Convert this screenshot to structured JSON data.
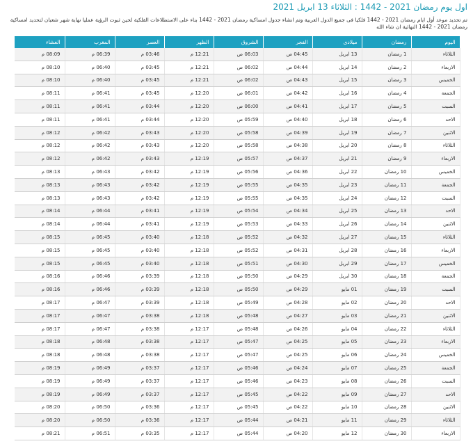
{
  "page": {
    "title": "اول يوم رمضان 2021 - 1442 : الثلاثاء 13 ابريل 2021",
    "intro": "تم تحديد موعد أول ايام رمضان 2021 - 1442 فلكيا فى جميع الدول العربية وتم انشاء جدول امساكية رمضان 2021 - 1442 بناء على الاستطلاعات الفلكية لحين ثبوت الرؤية عمليا نهاية شهر شعبان لتحديد امساكية رمضان 2021 - 1442 النهائية ان شاء الله"
  },
  "table": {
    "headers": [
      "اليوم",
      "رمضان",
      "ميلادى",
      "الفجر",
      "الشروق",
      "الظهر",
      "العصر",
      "المغرب",
      "العشاء"
    ],
    "rows": [
      [
        "الثلاثاء",
        "1 رمضان",
        "13 ابريل",
        "04:45 ص",
        "06:03 ص",
        "12:21 م",
        "03:46 م",
        "06:39 م",
        "08:09 م"
      ],
      [
        "الاربعاء",
        "2 رمضان",
        "14 ابريل",
        "04:44 ص",
        "06:02 ص",
        "12:21 م",
        "03:45 م",
        "06:40 م",
        "08:10 م"
      ],
      [
        "الخميس",
        "3 رمضان",
        "15 ابريل",
        "04:43 ص",
        "06:02 ص",
        "12:21 م",
        "03:45 م",
        "06:40 م",
        "08:10 م"
      ],
      [
        "الجمعة",
        "4 رمضان",
        "16 ابريل",
        "04:42 ص",
        "06:01 ص",
        "12:20 م",
        "03:45 م",
        "06:41 م",
        "08:11 م"
      ],
      [
        "السبت",
        "5 رمضان",
        "17 ابريل",
        "04:41 ص",
        "06:00 ص",
        "12:20 م",
        "03:44 م",
        "06:41 م",
        "08:11 م"
      ],
      [
        "الاحد",
        "6 رمضان",
        "18 ابريل",
        "04:40 ص",
        "05:59 ص",
        "12:20 م",
        "03:44 م",
        "06:41 م",
        "08:11 م"
      ],
      [
        "الاثنين",
        "7 رمضان",
        "19 ابريل",
        "04:39 ص",
        "05:58 ص",
        "12:20 م",
        "03:43 م",
        "06:42 م",
        "08:12 م"
      ],
      [
        "الثلاثاء",
        "8 رمضان",
        "20 ابريل",
        "04:38 ص",
        "05:58 ص",
        "12:20 م",
        "03:43 م",
        "06:42 م",
        "08:12 م"
      ],
      [
        "الاربعاء",
        "9 رمضان",
        "21 ابريل",
        "04:37 ص",
        "05:57 ص",
        "12:19 م",
        "03:43 م",
        "06:42 م",
        "08:12 م"
      ],
      [
        "الخميس",
        "10 رمضان",
        "22 ابريل",
        "04:36 ص",
        "05:56 ص",
        "12:19 م",
        "03:42 م",
        "06:43 م",
        "08:13 م"
      ],
      [
        "الجمعة",
        "11 رمضان",
        "23 ابريل",
        "04:35 ص",
        "05:55 ص",
        "12:19 م",
        "03:42 م",
        "06:43 م",
        "08:13 م"
      ],
      [
        "السبت",
        "12 رمضان",
        "24 ابريل",
        "04:35 ص",
        "05:55 ص",
        "12:19 م",
        "03:42 م",
        "06:43 م",
        "08:13 م"
      ],
      [
        "الاحد",
        "13 رمضان",
        "25 ابريل",
        "04:34 ص",
        "05:54 ص",
        "12:19 م",
        "03:41 م",
        "06:44 م",
        "08:14 م"
      ],
      [
        "الاثنين",
        "14 رمضان",
        "26 ابريل",
        "04:33 ص",
        "05:53 ص",
        "12:19 م",
        "03:41 م",
        "06:44 م",
        "08:14 م"
      ],
      [
        "الثلاثاء",
        "15 رمضان",
        "27 ابريل",
        "04:32 ص",
        "05:52 ص",
        "12:18 م",
        "03:40 م",
        "06:45 م",
        "08:15 م"
      ],
      [
        "الاربعاء",
        "16 رمضان",
        "28 ابريل",
        "04:31 ص",
        "05:52 ص",
        "12:18 م",
        "03:40 م",
        "06:45 م",
        "08:15 م"
      ],
      [
        "الخميس",
        "17 رمضان",
        "29 ابريل",
        "04:30 ص",
        "05:51 ص",
        "12:18 م",
        "03:40 م",
        "06:45 م",
        "08:15 م"
      ],
      [
        "الجمعة",
        "18 رمضان",
        "30 ابريل",
        "04:29 ص",
        "05:50 ص",
        "12:18 م",
        "03:39 م",
        "06:46 م",
        "08:16 م"
      ],
      [
        "السبت",
        "19 رمضان",
        "01 مايو",
        "04:29 ص",
        "05:50 ص",
        "12:18 م",
        "03:39 م",
        "06:46 م",
        "08:16 م"
      ],
      [
        "الاحد",
        "20 رمضان",
        "02 مايو",
        "04:28 ص",
        "05:49 ص",
        "12:18 م",
        "03:39 م",
        "06:47 م",
        "08:17 م"
      ],
      [
        "الاثنين",
        "21 رمضان",
        "03 مايو",
        "04:27 ص",
        "05:48 ص",
        "12:18 م",
        "03:38 م",
        "06:47 م",
        "08:17 م"
      ],
      [
        "الثلاثاء",
        "22 رمضان",
        "04 مايو",
        "04:26 ص",
        "05:48 ص",
        "12:17 م",
        "03:38 م",
        "06:47 م",
        "08:17 م"
      ],
      [
        "الاربعاء",
        "23 رمضان",
        "05 مايو",
        "04:25 ص",
        "05:47 ص",
        "12:17 م",
        "03:38 م",
        "06:48 م",
        "08:18 م"
      ],
      [
        "الخميس",
        "24 رمضان",
        "06 مايو",
        "04:25 ص",
        "05:47 ص",
        "12:17 م",
        "03:38 م",
        "06:48 م",
        "08:18 م"
      ],
      [
        "الجمعة",
        "25 رمضان",
        "07 مايو",
        "04:24 ص",
        "05:46 ص",
        "12:17 م",
        "03:37 م",
        "06:49 م",
        "08:19 م"
      ],
      [
        "السبت",
        "26 رمضان",
        "08 مايو",
        "04:23 ص",
        "05:46 ص",
        "12:17 م",
        "03:37 م",
        "06:49 م",
        "08:19 م"
      ],
      [
        "الاحد",
        "27 رمضان",
        "09 مايو",
        "04:22 ص",
        "05:45 ص",
        "12:17 م",
        "03:37 م",
        "06:49 م",
        "08:19 م"
      ],
      [
        "الاثنين",
        "28 رمضان",
        "10 مايو",
        "04:22 ص",
        "05:45 ص",
        "12:17 م",
        "03:36 م",
        "06:50 م",
        "08:20 م"
      ],
      [
        "الثلاثاء",
        "29 رمضان",
        "11 مايو",
        "04:21 ص",
        "05:44 ص",
        "12:17 م",
        "03:36 م",
        "06:50 م",
        "08:20 م"
      ],
      [
        "الاربعاء",
        "30 رمضان",
        "12 مايو",
        "04:20 ص",
        "05:44 ص",
        "12:17 م",
        "03:35 م",
        "06:51 م",
        "08:21 م"
      ]
    ]
  }
}
